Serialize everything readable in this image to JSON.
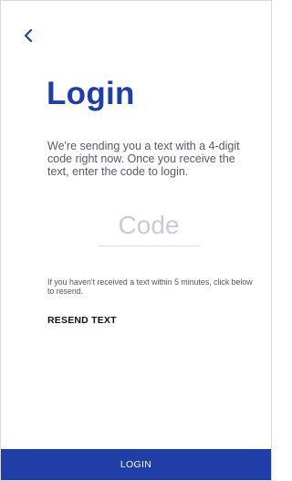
{
  "header": {
    "back_icon": "chevron-left-icon"
  },
  "title": "Login",
  "description": "We're sending you a text with a 4-digit code right now. Once you receive the text, enter the code to login.",
  "code_input": {
    "value": "",
    "placeholder": "Code"
  },
  "hint": "If you haven't received a text within 5 minutes, click below to resend.",
  "resend_label": "RESEND TEXT",
  "login_label": "LOGIN",
  "colors": {
    "accent": "#1f3ea8",
    "body_text": "#555b66",
    "placeholder": "#c9ccd2"
  }
}
